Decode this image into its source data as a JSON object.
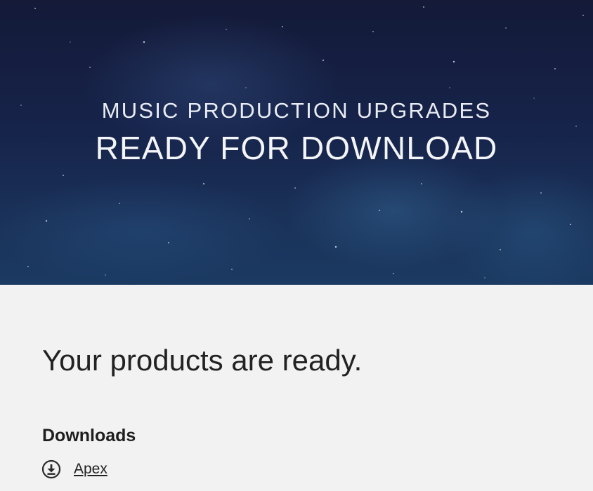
{
  "hero": {
    "line1": "MUSIC PRODUCTION UPGRADES",
    "line2": "READY FOR DOWNLOAD",
    "background_color": "#16234a"
  },
  "main": {
    "headline": "Your products are ready.",
    "downloads": {
      "heading": "Downloads",
      "items": [
        {
          "label": "Apex",
          "icon": "download-circle-icon"
        }
      ]
    }
  },
  "colors": {
    "page_background": "#f2f2f2",
    "text": "#222222",
    "hero_text": "#f4f5f8"
  }
}
